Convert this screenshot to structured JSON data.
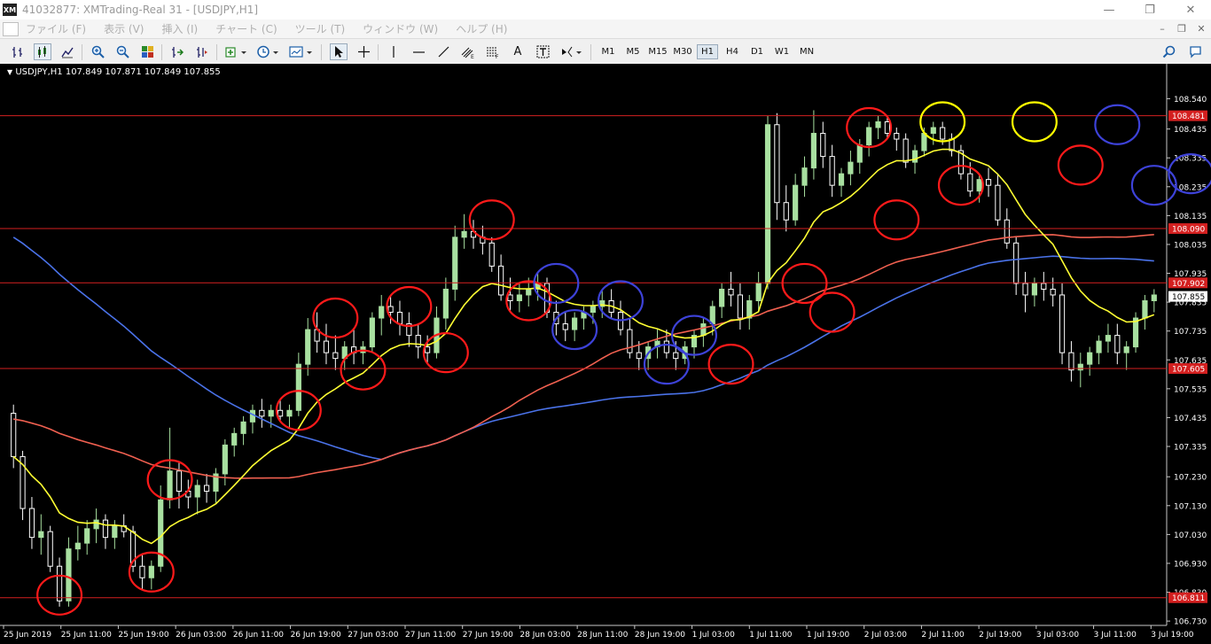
{
  "window": {
    "title": "41032877: XMTrading-Real 31 - [USDJPY,H1]",
    "app_icon": "XM",
    "buttons": [
      "minimize-icon",
      "restore-icon",
      "close-icon"
    ]
  },
  "menu": {
    "items": [
      "ファイル (F)",
      "表示 (V)",
      "挿入 (I)",
      "チャート (C)",
      "ツール (T)",
      "ウィンドウ (W)",
      "ヘルプ (H)"
    ]
  },
  "toolbar": {
    "timeframes": [
      "M1",
      "M5",
      "M15",
      "M30",
      "H1",
      "H4",
      "D1",
      "W1",
      "MN"
    ],
    "active_timeframe": "H1",
    "text_tool_label": "A"
  },
  "chart_header": {
    "symbol": "USDJPY,H1",
    "ohlc": "107.849 107.871 107.849 107.855"
  },
  "chart_data": {
    "type": "candlestick",
    "symbol": "USDJPY",
    "timeframe": "H1",
    "ylim": [
      106.715,
      108.615
    ],
    "price_ticks": [
      "108.540",
      "108.435",
      "108.335",
      "108.235",
      "108.135",
      "108.035",
      "107.935",
      "107.835",
      "107.735",
      "107.635",
      "107.535",
      "107.435",
      "107.335",
      "107.230",
      "107.130",
      "107.030",
      "106.930",
      "106.830",
      "106.730"
    ],
    "time_labels": [
      "25 Jun 2019",
      "25 Jun 11:00",
      "25 Jun 19:00",
      "26 Jun 03:00",
      "26 Jun 11:00",
      "26 Jun 19:00",
      "27 Jun 03:00",
      "27 Jun 11:00",
      "27 Jun 19:00",
      "28 Jun 03:00",
      "28 Jun 11:00",
      "28 Jun 19:00",
      "1 Jul 03:00",
      "1 Jul 11:00",
      "1 Jul 19:00",
      "2 Jul 03:00",
      "2 Jul 11:00",
      "2 Jul 19:00",
      "3 Jul 03:00",
      "3 Jul 11:00",
      "3 Jul 19:00"
    ],
    "horizontal_lines": [
      {
        "price": 108.481,
        "label": "108.481"
      },
      {
        "price": 108.09,
        "label": "108.090"
      },
      {
        "price": 107.902,
        "label": "107.902"
      },
      {
        "price": 107.605,
        "label": "107.605"
      },
      {
        "price": 106.811,
        "label": "106.811"
      }
    ],
    "current_price": "107.855",
    "colors": {
      "background": "#000000",
      "candle_bull": "#a8e0a0",
      "candle_bear": "#ffffff",
      "level_line": "#d42020",
      "ma_fast": "#ffff33",
      "ma_mid": "#f06050",
      "ma_slow": "#4a72e8",
      "circle_red": "#ff1a1a",
      "circle_yellow": "#ffff00",
      "circle_blue": "#3d42d8"
    },
    "ohlc_sample_hourly_from_25_Jun_2019": [
      [
        107.45,
        107.48,
        107.26,
        107.3
      ],
      [
        107.3,
        107.32,
        107.08,
        107.12
      ],
      [
        107.12,
        107.16,
        106.98,
        107.02
      ],
      [
        107.02,
        107.1,
        106.96,
        107.04
      ],
      [
        107.04,
        107.06,
        106.9,
        106.92
      ],
      [
        106.92,
        106.95,
        106.78,
        106.8
      ],
      [
        106.8,
        107.02,
        106.78,
        106.98
      ],
      [
        106.98,
        107.06,
        106.94,
        107.0
      ],
      [
        107.0,
        107.08,
        106.96,
        107.05
      ],
      [
        107.05,
        107.12,
        107.0,
        107.08
      ],
      [
        107.08,
        107.1,
        106.98,
        107.02
      ],
      [
        107.02,
        107.08,
        106.98,
        107.06
      ],
      [
        107.06,
        107.1,
        107.02,
        107.04
      ],
      [
        107.04,
        107.06,
        106.9,
        106.92
      ],
      [
        106.92,
        106.96,
        106.84,
        106.88
      ],
      [
        106.88,
        106.94,
        106.84,
        106.92
      ],
      [
        106.92,
        107.2,
        106.9,
        107.15
      ],
      [
        107.15,
        107.4,
        107.12,
        107.25
      ],
      [
        107.25,
        107.28,
        107.12,
        107.18
      ],
      [
        107.18,
        107.22,
        107.12,
        107.16
      ],
      [
        107.16,
        107.22,
        107.1,
        107.2
      ],
      [
        107.2,
        107.24,
        107.14,
        107.18
      ],
      [
        107.18,
        107.26,
        107.14,
        107.24
      ],
      [
        107.24,
        107.36,
        107.2,
        107.34
      ],
      [
        107.34,
        107.4,
        107.3,
        107.38
      ],
      [
        107.38,
        107.44,
        107.34,
        107.42
      ],
      [
        107.42,
        107.48,
        107.38,
        107.46
      ],
      [
        107.46,
        107.5,
        107.4,
        107.44
      ],
      [
        107.44,
        107.48,
        107.4,
        107.46
      ],
      [
        107.46,
        107.5,
        107.42,
        107.44
      ],
      [
        107.44,
        107.48,
        107.4,
        107.46
      ],
      [
        107.46,
        107.66,
        107.44,
        107.62
      ],
      [
        107.62,
        107.78,
        107.58,
        107.74
      ],
      [
        107.74,
        107.8,
        107.66,
        107.7
      ],
      [
        107.7,
        107.76,
        107.62,
        107.66
      ],
      [
        107.66,
        107.72,
        107.6,
        107.64
      ],
      [
        107.64,
        107.7,
        107.6,
        107.68
      ],
      [
        107.68,
        107.74,
        107.62,
        107.66
      ],
      [
        107.66,
        107.7,
        107.62,
        107.68
      ],
      [
        107.68,
        107.8,
        107.66,
        107.78
      ],
      [
        107.78,
        107.86,
        107.72,
        107.82
      ],
      [
        107.82,
        107.86,
        107.76,
        107.8
      ],
      [
        107.8,
        107.84,
        107.72,
        107.76
      ],
      [
        107.76,
        107.8,
        107.68,
        107.72
      ],
      [
        107.72,
        107.76,
        107.64,
        107.68
      ],
      [
        107.68,
        107.72,
        107.62,
        107.66
      ],
      [
        107.66,
        107.82,
        107.64,
        107.78
      ],
      [
        107.78,
        107.92,
        107.74,
        107.88
      ],
      [
        107.88,
        108.1,
        107.84,
        108.06
      ],
      [
        108.06,
        108.14,
        108.02,
        108.08
      ],
      [
        108.08,
        108.12,
        108.02,
        108.06
      ],
      [
        108.06,
        108.1,
        108.0,
        108.04
      ],
      [
        108.04,
        108.06,
        107.94,
        107.96
      ],
      [
        107.96,
        108.0,
        107.84,
        107.86
      ],
      [
        107.86,
        107.92,
        107.8,
        107.84
      ],
      [
        107.84,
        107.9,
        107.8,
        107.86
      ],
      [
        107.86,
        107.92,
        107.82,
        107.88
      ],
      [
        107.88,
        107.94,
        107.84,
        107.9
      ],
      [
        107.9,
        107.92,
        107.78,
        107.8
      ],
      [
        107.8,
        107.84,
        107.72,
        107.76
      ],
      [
        107.76,
        107.8,
        107.7,
        107.74
      ],
      [
        107.74,
        107.8,
        107.7,
        107.78
      ],
      [
        107.78,
        107.82,
        107.74,
        107.8
      ],
      [
        107.8,
        107.84,
        107.76,
        107.82
      ],
      [
        107.82,
        107.88,
        107.78,
        107.84
      ],
      [
        107.84,
        107.88,
        107.78,
        107.8
      ],
      [
        107.8,
        107.84,
        107.72,
        107.74
      ],
      [
        107.74,
        107.78,
        107.64,
        107.66
      ],
      [
        107.66,
        107.7,
        107.6,
        107.64
      ],
      [
        107.64,
        107.7,
        107.6,
        107.68
      ],
      [
        107.68,
        107.74,
        107.64,
        107.7
      ],
      [
        107.7,
        107.74,
        107.64,
        107.66
      ],
      [
        107.66,
        107.7,
        107.6,
        107.64
      ],
      [
        107.64,
        107.7,
        107.62,
        107.68
      ],
      [
        107.68,
        107.74,
        107.64,
        107.72
      ],
      [
        107.72,
        107.78,
        107.68,
        107.76
      ],
      [
        107.76,
        107.84,
        107.72,
        107.82
      ],
      [
        107.82,
        107.9,
        107.78,
        107.88
      ],
      [
        107.88,
        107.94,
        107.82,
        107.86
      ],
      [
        107.86,
        107.9,
        107.74,
        107.78
      ],
      [
        107.78,
        107.86,
        107.74,
        107.84
      ],
      [
        107.84,
        107.94,
        107.8,
        107.9
      ],
      [
        107.9,
        108.48,
        107.88,
        108.45
      ],
      [
        108.45,
        108.49,
        108.12,
        108.18
      ],
      [
        108.18,
        108.24,
        108.08,
        108.12
      ],
      [
        108.12,
        108.28,
        108.1,
        108.24
      ],
      [
        108.24,
        108.34,
        108.2,
        108.3
      ],
      [
        108.3,
        108.5,
        108.26,
        108.42
      ],
      [
        108.42,
        108.46,
        108.3,
        108.34
      ],
      [
        108.34,
        108.38,
        108.2,
        108.24
      ],
      [
        108.24,
        108.3,
        108.2,
        108.28
      ],
      [
        108.28,
        108.36,
        108.24,
        108.32
      ],
      [
        108.32,
        108.4,
        108.28,
        108.38
      ],
      [
        108.38,
        108.46,
        108.34,
        108.44
      ],
      [
        108.44,
        108.48,
        108.4,
        108.46
      ],
      [
        108.46,
        108.48,
        108.4,
        108.42
      ],
      [
        108.42,
        108.44,
        108.36,
        108.4
      ],
      [
        108.4,
        108.42,
        108.3,
        108.32
      ],
      [
        108.32,
        108.38,
        108.28,
        108.36
      ],
      [
        108.36,
        108.44,
        108.34,
        108.42
      ],
      [
        108.42,
        108.46,
        108.38,
        108.44
      ],
      [
        108.44,
        108.46,
        108.38,
        108.4
      ],
      [
        108.4,
        108.42,
        108.34,
        108.36
      ],
      [
        108.36,
        108.38,
        108.26,
        108.28
      ],
      [
        108.28,
        108.32,
        108.2,
        108.22
      ],
      [
        108.22,
        108.28,
        108.18,
        108.26
      ],
      [
        108.26,
        108.3,
        108.2,
        108.24
      ],
      [
        108.24,
        108.28,
        108.1,
        108.12
      ],
      [
        108.12,
        108.16,
        108.02,
        108.04
      ],
      [
        108.04,
        108.06,
        107.86,
        107.9
      ],
      [
        107.9,
        107.94,
        107.8,
        107.86
      ],
      [
        107.86,
        107.92,
        107.82,
        107.9
      ],
      [
        107.9,
        107.94,
        107.84,
        107.88
      ],
      [
        107.88,
        107.92,
        107.82,
        107.86
      ],
      [
        107.86,
        107.9,
        107.62,
        107.66
      ],
      [
        107.66,
        107.7,
        107.56,
        107.6
      ],
      [
        107.6,
        107.66,
        107.54,
        107.62
      ],
      [
        107.62,
        107.68,
        107.58,
        107.66
      ],
      [
        107.66,
        107.72,
        107.62,
        107.7
      ],
      [
        107.7,
        107.76,
        107.66,
        107.72
      ],
      [
        107.72,
        107.76,
        107.62,
        107.66
      ],
      [
        107.66,
        107.7,
        107.6,
        107.68
      ],
      [
        107.68,
        107.8,
        107.66,
        107.78
      ],
      [
        107.78,
        107.86,
        107.74,
        107.84
      ],
      [
        107.84,
        107.88,
        107.8,
        107.86
      ]
    ],
    "annotation_circles": [
      {
        "color": "red",
        "time_index": 5,
        "price": 106.82
      },
      {
        "color": "red",
        "time_index": 15,
        "price": 106.9
      },
      {
        "color": "red",
        "time_index": 17,
        "price": 107.22
      },
      {
        "color": "red",
        "time_index": 31,
        "price": 107.46
      },
      {
        "color": "red",
        "time_index": 35,
        "price": 107.78
      },
      {
        "color": "red",
        "time_index": 38,
        "price": 107.6
      },
      {
        "color": "red",
        "time_index": 43,
        "price": 107.82
      },
      {
        "color": "red",
        "time_index": 47,
        "price": 107.66
      },
      {
        "color": "red",
        "time_index": 52,
        "price": 108.12
      },
      {
        "color": "red",
        "time_index": 56,
        "price": 107.84
      },
      {
        "color": "blue",
        "time_index": 59,
        "price": 107.9
      },
      {
        "color": "blue",
        "time_index": 61,
        "price": 107.74
      },
      {
        "color": "blue",
        "time_index": 66,
        "price": 107.84
      },
      {
        "color": "blue",
        "time_index": 71,
        "price": 107.62
      },
      {
        "color": "blue",
        "time_index": 74,
        "price": 107.72
      },
      {
        "color": "red",
        "time_index": 78,
        "price": 107.62
      },
      {
        "color": "red",
        "time_index": 86,
        "price": 107.9
      },
      {
        "color": "red",
        "time_index": 89,
        "price": 107.8
      },
      {
        "color": "red",
        "time_index": 93,
        "price": 108.44
      },
      {
        "color": "red",
        "time_index": 96,
        "price": 108.12
      },
      {
        "color": "yellow",
        "time_index": 101,
        "price": 108.46
      },
      {
        "color": "red",
        "time_index": 103,
        "price": 108.24
      },
      {
        "color": "yellow",
        "time_index": 111,
        "price": 108.46
      },
      {
        "color": "red",
        "time_index": 116,
        "price": 108.31
      },
      {
        "color": "blue",
        "time_index": 120,
        "price": 108.45
      },
      {
        "color": "blue",
        "time_index": 124,
        "price": 108.24
      },
      {
        "color": "blue",
        "time_index": 128,
        "price": 108.28
      }
    ]
  }
}
